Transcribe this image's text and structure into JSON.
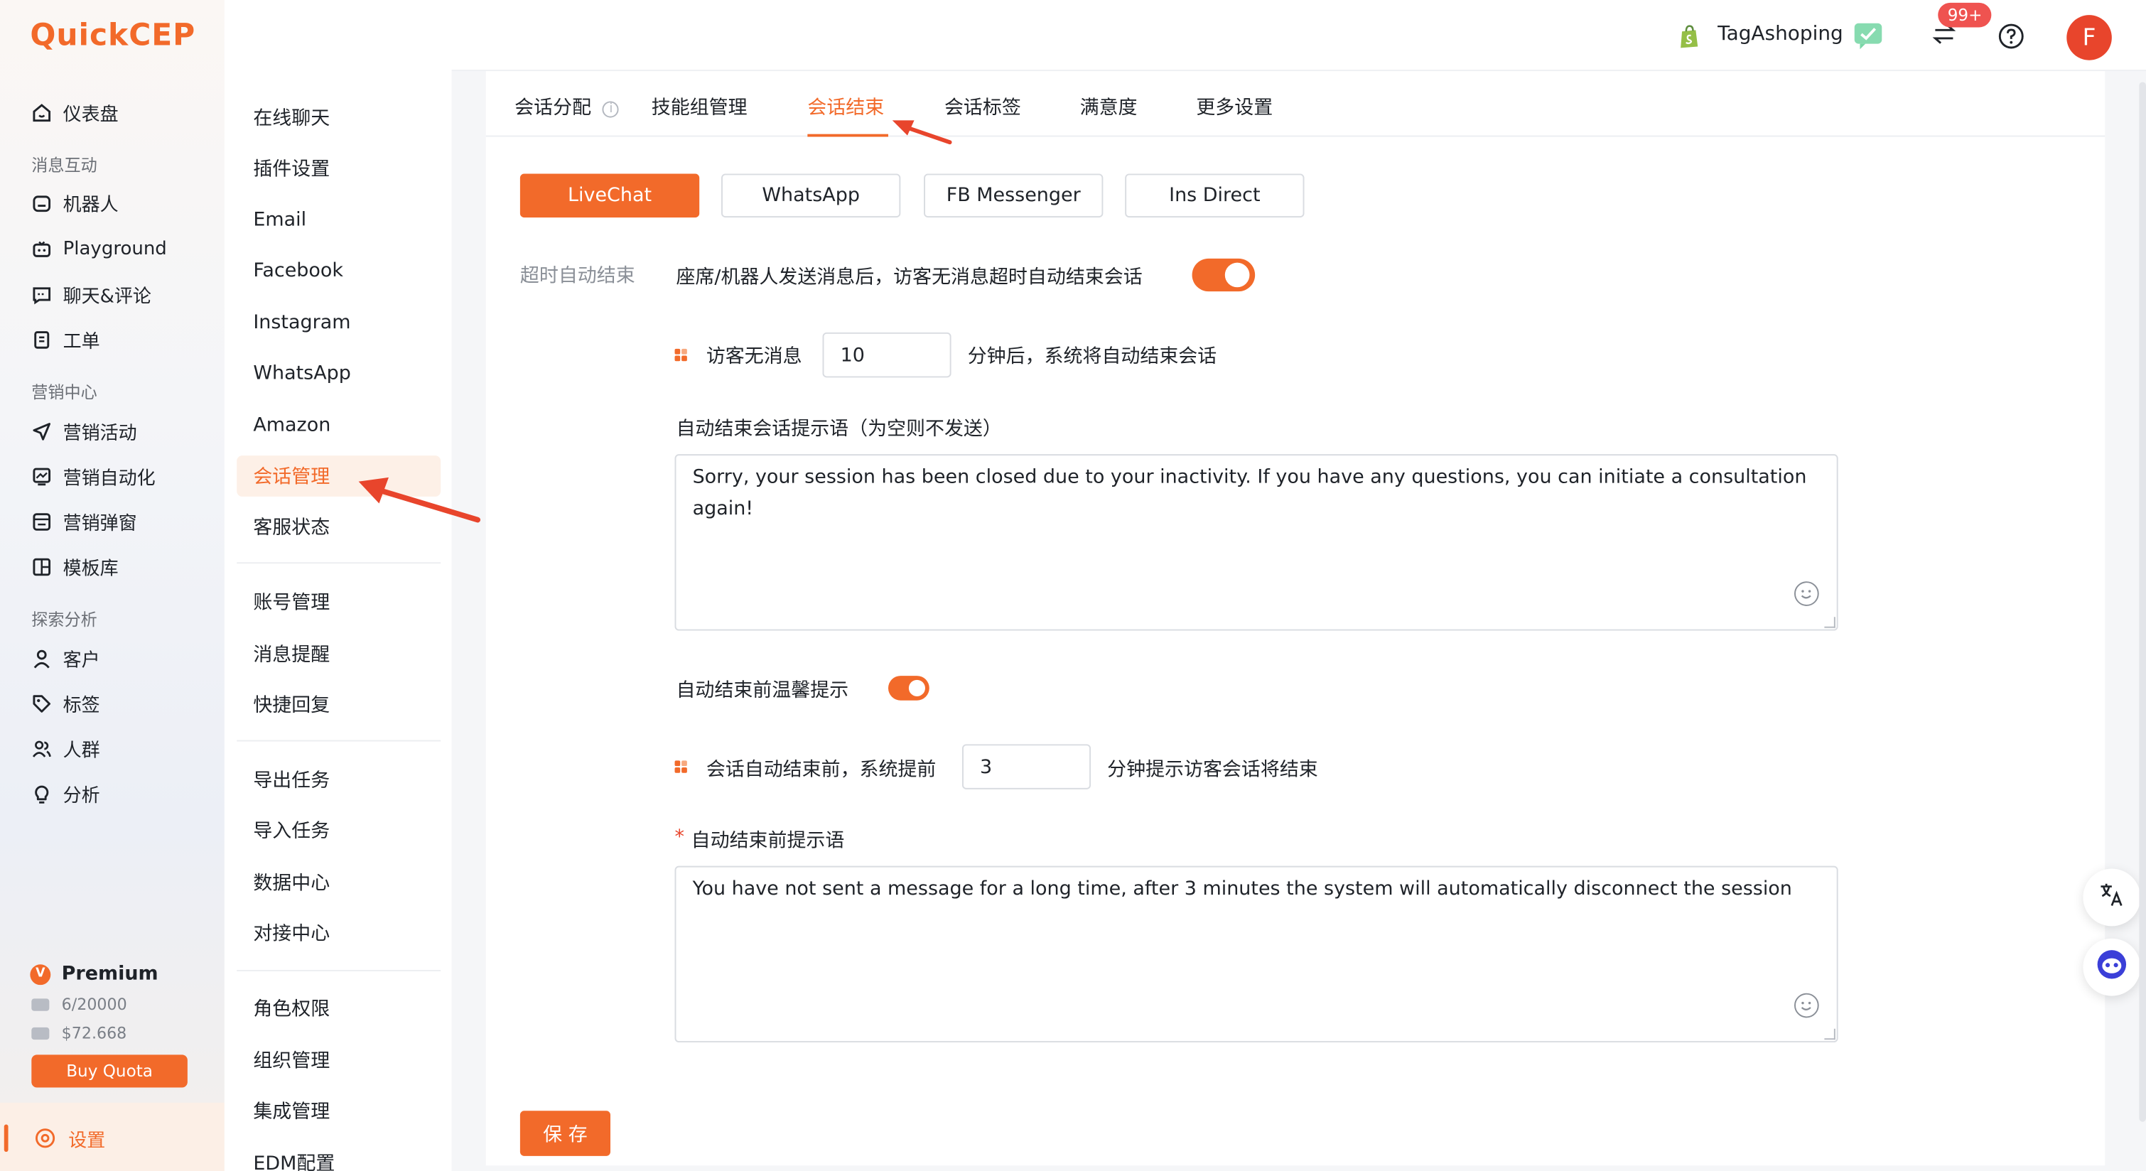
{
  "app": {
    "logo": "QuickCEP",
    "page_title": "设置"
  },
  "header": {
    "store_name": "TagAshoping",
    "notification_count": "99+",
    "avatar_letter": "F"
  },
  "sidebar": {
    "items_top": [
      {
        "label": "仪表盘",
        "icon": "home-icon"
      }
    ],
    "sections": [
      {
        "title": "消息互动",
        "items": [
          {
            "label": "机器人",
            "icon": "robot-icon"
          },
          {
            "label": "Playground",
            "icon": "playground-icon"
          },
          {
            "label": "聊天&评论",
            "icon": "chat-icon"
          },
          {
            "label": "工单",
            "icon": "ticket-icon"
          }
        ]
      },
      {
        "title": "营销中心",
        "items": [
          {
            "label": "营销活动",
            "icon": "send-icon"
          },
          {
            "label": "营销自动化",
            "icon": "automation-icon"
          },
          {
            "label": "营销弹窗",
            "icon": "popup-icon"
          },
          {
            "label": "模板库",
            "icon": "template-icon"
          }
        ]
      },
      {
        "title": "探索分析",
        "items": [
          {
            "label": "客户",
            "icon": "user-icon"
          },
          {
            "label": "标签",
            "icon": "tag-icon"
          },
          {
            "label": "人群",
            "icon": "group-icon"
          },
          {
            "label": "分析",
            "icon": "bulb-icon"
          }
        ]
      }
    ],
    "premium": {
      "label": "Premium",
      "messages": "6/20000",
      "balance": "$72.668",
      "buy_label": "Buy Quota"
    },
    "settings_label": "设置"
  },
  "subnav": {
    "group1": [
      "在线聊天",
      "插件设置",
      "Email",
      "Facebook",
      "Instagram",
      "WhatsApp",
      "Amazon",
      "会话管理",
      "客服状态"
    ],
    "group2": [
      "账号管理",
      "消息提醒",
      "快捷回复"
    ],
    "group3": [
      "导出任务",
      "导入任务",
      "数据中心",
      "对接中心"
    ],
    "group4": [
      "角色权限",
      "组织管理",
      "集成管理",
      "EDM配置"
    ],
    "active": "会话管理"
  },
  "tabs": [
    {
      "label": "会话分配"
    },
    {
      "label": "技能组管理"
    },
    {
      "label": "会话结束"
    },
    {
      "label": "会话标签"
    },
    {
      "label": "满意度"
    },
    {
      "label": "更多设置"
    }
  ],
  "active_tab": "会话结束",
  "channels": [
    "LiveChat",
    "WhatsApp",
    "FB Messenger",
    "Ins Direct"
  ],
  "active_channel": "LiveChat",
  "form": {
    "timeout_section_label": "超时自动结束",
    "timeout_desc": "座席/机器人发送消息后，访客无消息超时自动结束会话",
    "timeout_enabled": true,
    "visitor_idle_prefix": "访客无消息",
    "visitor_idle_minutes": "10",
    "visitor_idle_suffix": "分钟后，系统将自动结束会话",
    "end_msg_label": "自动结束会话提示语（为空则不发送）",
    "end_msg_text": "Sorry, your session has been closed due to your inactivity. If you have any questions, you can initiate a consultation again!",
    "warn_label": "自动结束前温馨提示",
    "warn_enabled": true,
    "warn_prefix": "会话自动结束前，系统提前",
    "warn_minutes": "3",
    "warn_suffix": "分钟提示访客会话将结束",
    "warn_msg_required": "*",
    "warn_msg_label": "自动结束前提示语",
    "warn_msg_text": "You have not sent a message for a long time, after 3 minutes the system will automatically disconnect the session",
    "save_label": "保 存"
  },
  "colors": {
    "accent": "#f26a2a",
    "annotation_arrow": "#e8452c"
  }
}
